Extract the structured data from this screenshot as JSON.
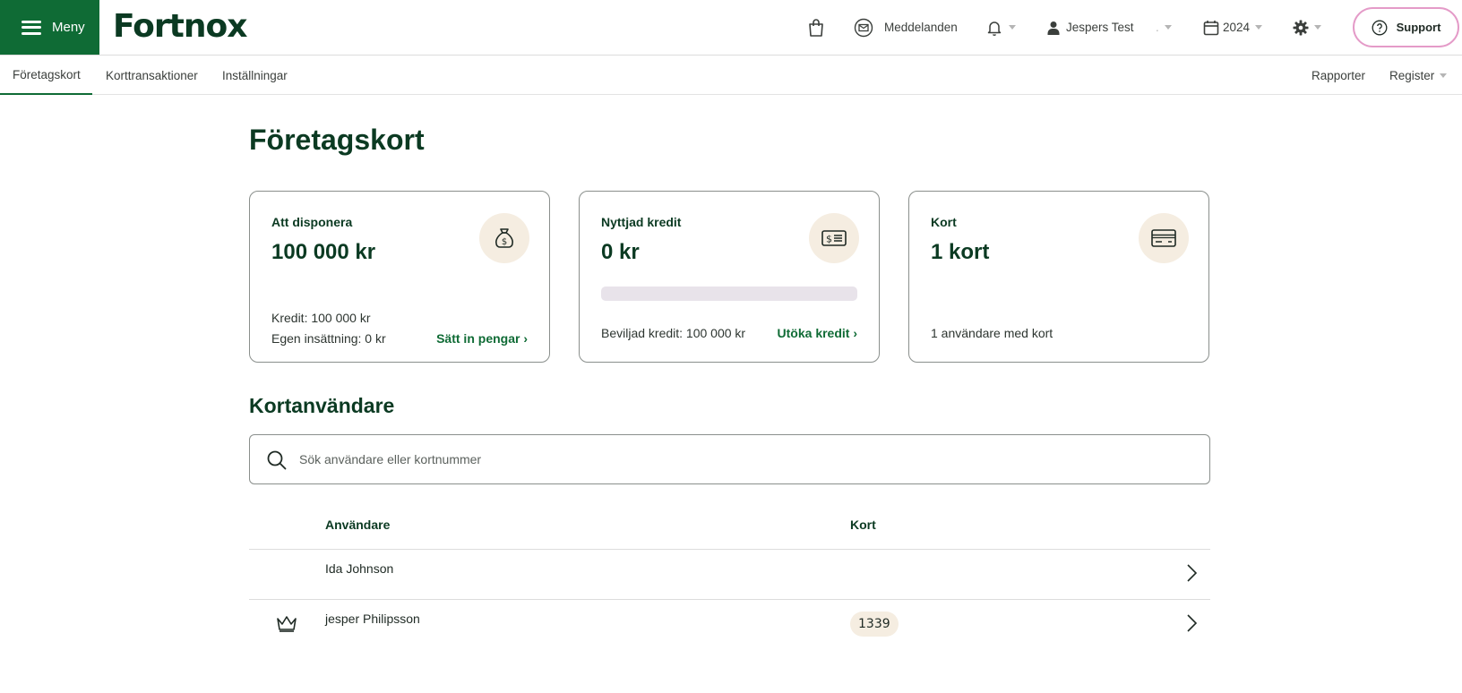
{
  "header": {
    "menu_label": "Meny",
    "logo_text": "Fortnox",
    "messages_label": "Meddelanden",
    "user_label": "Jespers Test",
    "company_label": ".",
    "year_label": "2024",
    "support_label": "Support"
  },
  "subnav": {
    "tabs": [
      {
        "label": "Företagskort",
        "active": true
      },
      {
        "label": "Korttransaktioner",
        "active": false
      },
      {
        "label": "Inställningar",
        "active": false
      }
    ],
    "reports_label": "Rapporter",
    "register_label": "Register"
  },
  "main": {
    "title": "Företagskort",
    "cards": [
      {
        "label": "Att disponera",
        "value": "100 000 kr",
        "icon": "money-bag-icon",
        "credit_line": "Kredit: 100 000 kr",
        "deposit_line": "Egen insättning: 0 kr",
        "link": "Sätt in pengar ›"
      },
      {
        "label": "Nyttjad kredit",
        "value": "0 kr",
        "icon": "bill-icon",
        "usage_fraction": 0,
        "granted_line": "Beviljad kredit: 100 000 kr",
        "link": "Utöka kredit ›"
      },
      {
        "label": "Kort",
        "value": "1 kort",
        "icon": "credit-card-icon",
        "users_line": "1 användare med kort"
      }
    ],
    "users_section": {
      "title": "Kortanvändare",
      "search_placeholder": "Sök användare eller kortnummer",
      "columns": [
        "Användare",
        "Kort"
      ],
      "rows": [
        {
          "name": "Ida Johnson",
          "card": "",
          "owner": false
        },
        {
          "name": "jesper Philipsson",
          "card": "1339",
          "owner": true
        }
      ]
    }
  },
  "colors": {
    "brand_green": "#0f6b35",
    "dark_green_text": "#0b3a22",
    "support_border": "#e49bc8",
    "icon_bg": "#f5ede1"
  }
}
